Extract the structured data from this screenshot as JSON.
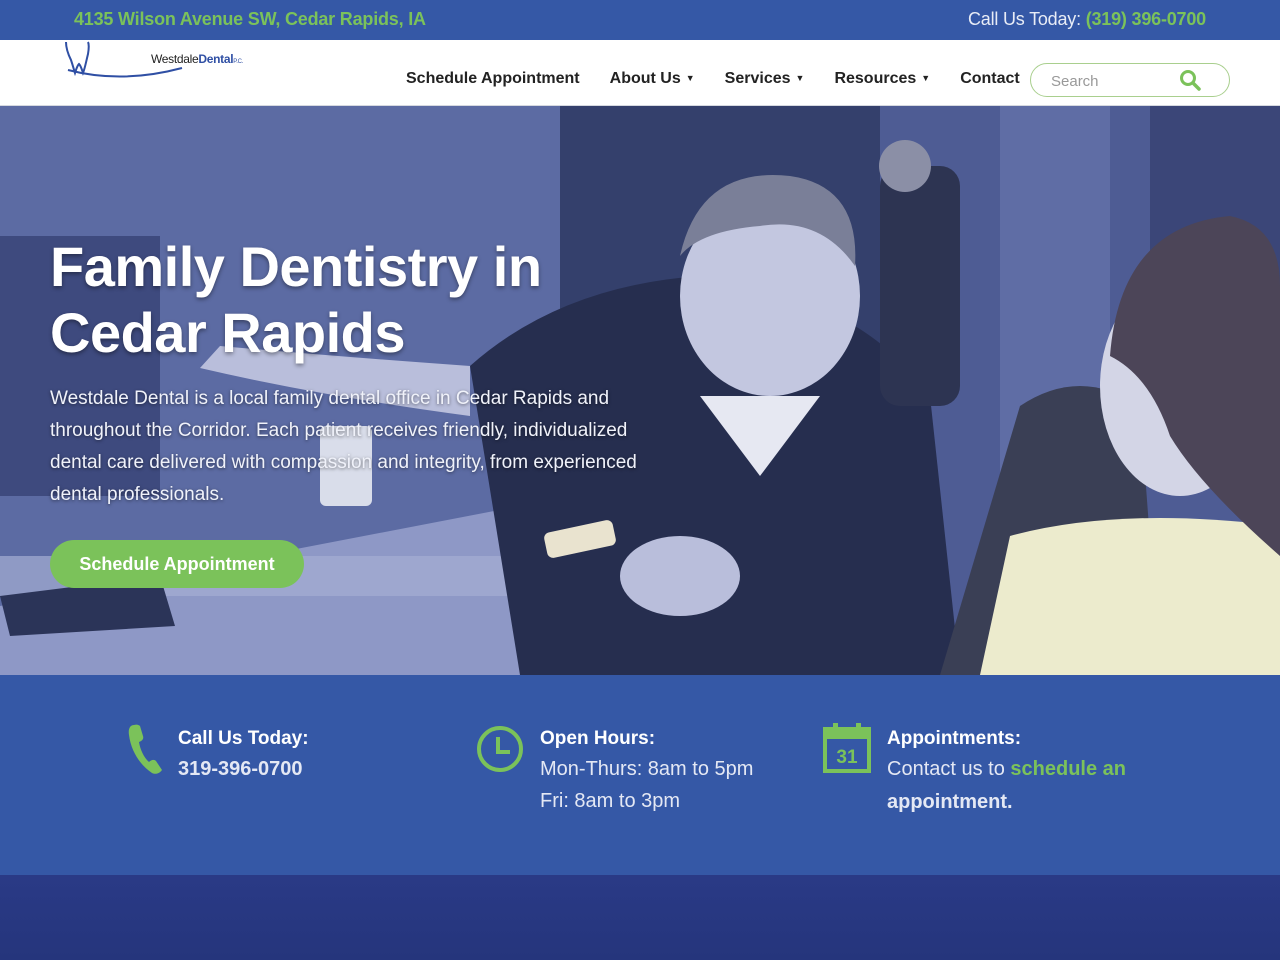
{
  "topbar": {
    "address": "4135 Wilson Avenue SW, Cedar Rapids, IA",
    "call_label": "Call Us Today: ",
    "call_phone": "(319) 396-0700"
  },
  "logo": {
    "name_part1": "Westdale",
    "name_part2": "Dental",
    "suffix": "P.C."
  },
  "nav": {
    "items": [
      {
        "label": "Schedule Appointment",
        "has_dropdown": false
      },
      {
        "label": "About Us",
        "has_dropdown": true
      },
      {
        "label": "Services",
        "has_dropdown": true
      },
      {
        "label": "Resources",
        "has_dropdown": true
      },
      {
        "label": "Contact",
        "has_dropdown": false
      }
    ],
    "search_placeholder": "Search"
  },
  "hero": {
    "title_line1": "Family Dentistry in",
    "title_line2": "Cedar Rapids",
    "body": "Westdale Dental is a local family dental office in Cedar Rapids and throughout the Corridor. Each patient receives friendly, individualized dental care delivered with compassion and integrity, from experienced dental professionals.",
    "cta": "Schedule Appointment"
  },
  "info": {
    "call": {
      "title": "Call Us Today:",
      "phone": "319-396-0700"
    },
    "hours": {
      "title": "Open Hours:",
      "line1": "Mon-Thurs: 8am to 5pm",
      "line2": "Fri: 8am to 3pm"
    },
    "appointments": {
      "title": "Appointments:",
      "text": "Contact us to ",
      "link_line1": "schedule an",
      "link_line2": "appointment.",
      "calendar_day": "31"
    }
  },
  "colors": {
    "brand_blue": "#3558a6",
    "accent_green": "#7bc25a",
    "dark_blue": "#2a3a86"
  }
}
